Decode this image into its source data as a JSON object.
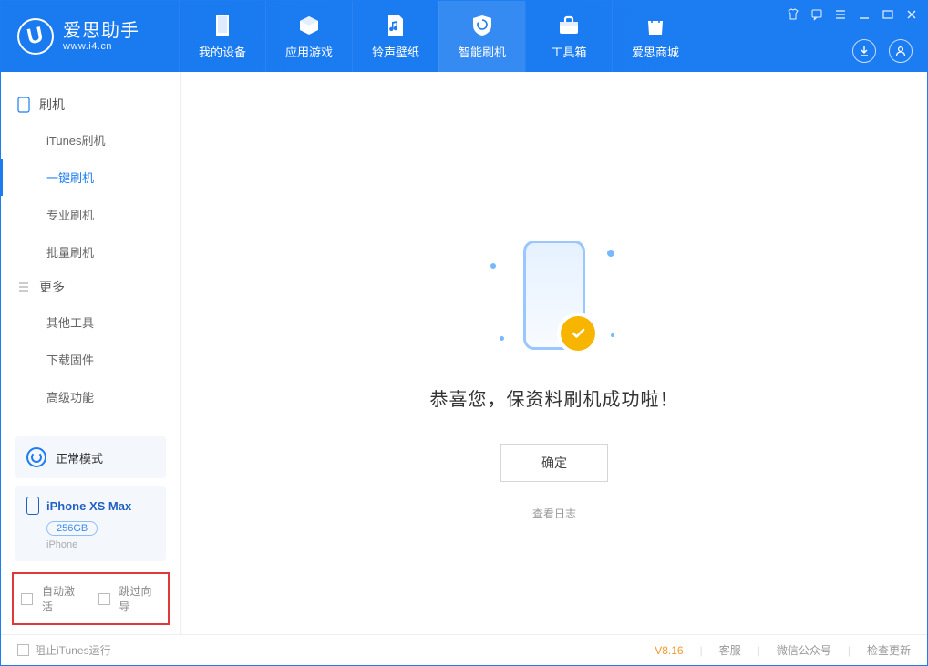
{
  "brand": {
    "title": "爱思助手",
    "subtitle": "www.i4.cn"
  },
  "nav": {
    "tabs": [
      {
        "label": "我的设备"
      },
      {
        "label": "应用游戏"
      },
      {
        "label": "铃声壁纸"
      },
      {
        "label": "智能刷机"
      },
      {
        "label": "工具箱"
      },
      {
        "label": "爱思商城"
      }
    ]
  },
  "sidebar": {
    "group1_title": "刷机",
    "group1_items": [
      {
        "label": "iTunes刷机"
      },
      {
        "label": "一键刷机"
      },
      {
        "label": "专业刷机"
      },
      {
        "label": "批量刷机"
      }
    ],
    "group2_title": "更多",
    "group2_items": [
      {
        "label": "其他工具"
      },
      {
        "label": "下载固件"
      },
      {
        "label": "高级功能"
      }
    ],
    "mode_label": "正常模式",
    "device": {
      "name": "iPhone XS Max",
      "capacity": "256GB",
      "type": "iPhone"
    },
    "options": {
      "auto_activate": "自动激活",
      "skip_guide": "跳过向导"
    }
  },
  "main": {
    "success_msg": "恭喜您，保资料刷机成功啦！",
    "ok_label": "确定",
    "log_link": "查看日志"
  },
  "statusbar": {
    "block_itunes": "阻止iTunes运行",
    "version": "V8.16",
    "links": [
      "客服",
      "微信公众号",
      "检查更新"
    ]
  }
}
